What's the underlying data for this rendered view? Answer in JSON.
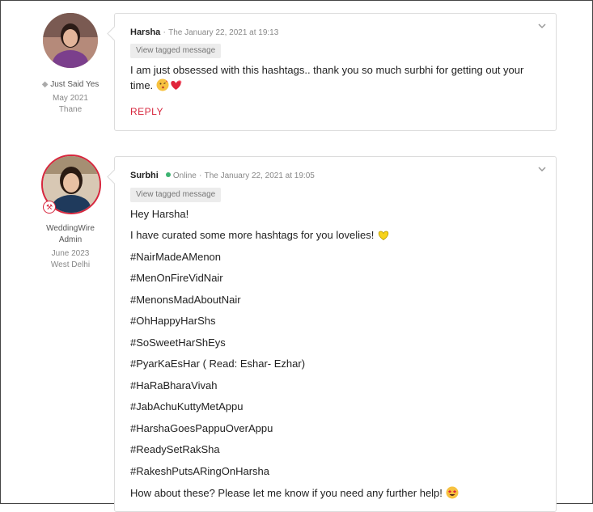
{
  "posts": [
    {
      "author": "Harsha",
      "date": "The January 22, 2021 at 19:13",
      "tag_button": "View tagged message",
      "badge": "Just Said Yes",
      "member_since": "May 2021",
      "location": "Thane",
      "message": "I am just obsessed with this hashtags.. thank you so much surbhi for getting out your time.",
      "reply": "REPLY"
    },
    {
      "author": "Surbhi",
      "status": "Online",
      "date": "The January 22, 2021 at 19:05",
      "tag_button": "View tagged message",
      "role_line1": "WeddingWire",
      "role_line2": "Admin",
      "member_since": "June 2023",
      "location": "West Delhi",
      "lines": [
        "Hey Harsha!",
        "I have curated some more hashtags for you lovelies!",
        "#NairMadeAMenon",
        "#MenOnFireVidNair",
        "#MenonsMadAboutNair",
        "#OhHappyHarShs",
        "#SoSweetHarShEys",
        "#PyarKaEsHar ( Read: Eshar- Ezhar)",
        "#HaRaBharaVivah",
        "#JabAchuKuttyMetAppu",
        "#HarshaGoesPappuOverAppu",
        "#ReadySetRakSha",
        "#RakeshPutsARingOnHarsha",
        "How about these? Please let me know if you need any further help!"
      ]
    }
  ],
  "colors": {
    "accent": "#d7263d",
    "online": "#3cb371",
    "muted": "#888888",
    "border": "#dcdcdc"
  },
  "icons": [
    "diamond-icon",
    "chevron-down-icon",
    "admin-badge-icon",
    "kiss-emoji",
    "heart-emoji",
    "yellow-heart-emoji",
    "star-eyes-emoji"
  ]
}
